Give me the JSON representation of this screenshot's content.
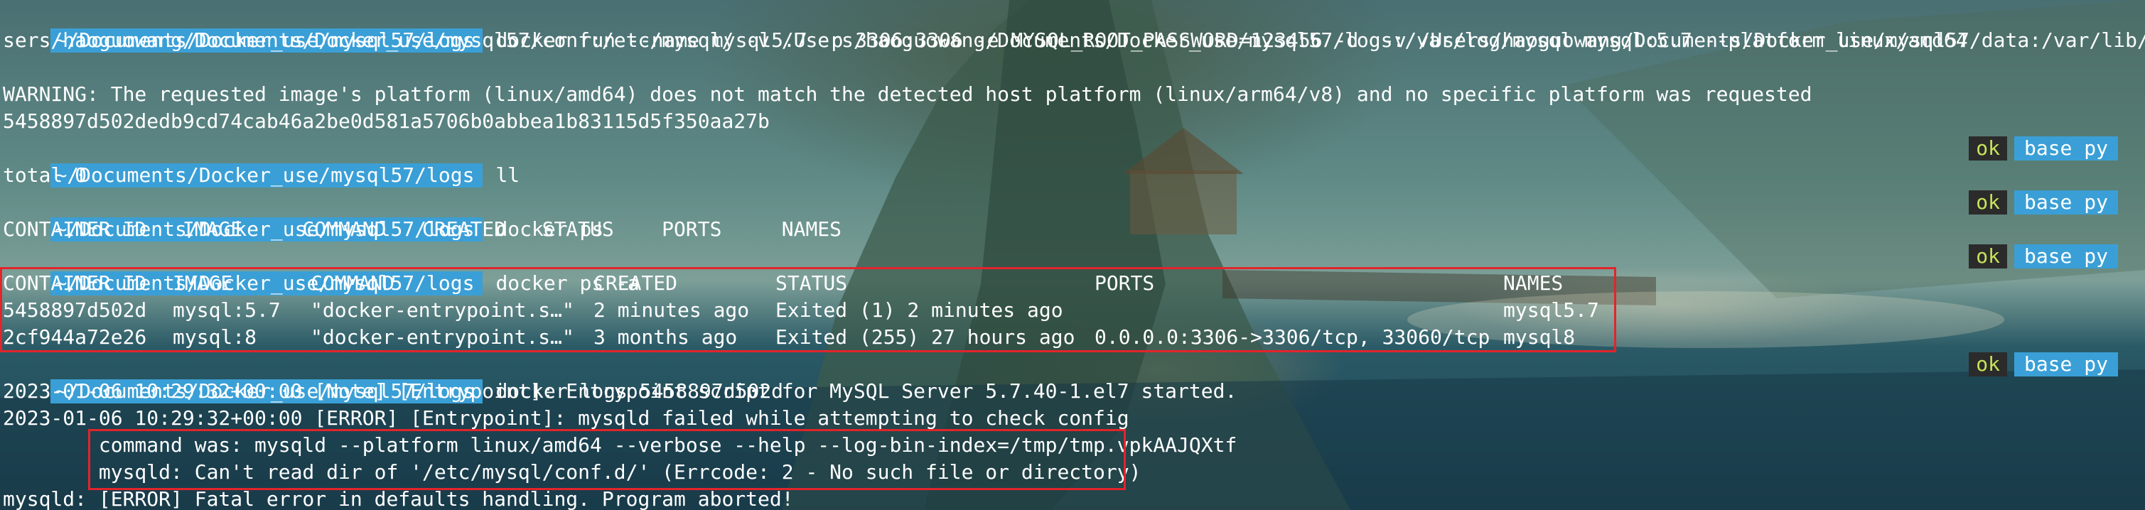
{
  "terminal": {
    "prompt_path": "~/Documents/Docker_use/mysql57/logs",
    "run_command_line1": "docker run --name mysql5.7 -p 3306:3306 -e MYSQL_ROOT_PASSWORD=123456 -d  -v /Users/haoguowang/Documents/Docker_use/mysql57/data:/var/lib/mysql -v /U",
    "run_command_line2": "sers/haoguowang/Documents/Docker_use/mysql57/conf:/etc/mysql/ -v /Users/haoguowang/Documents/Docker_use/mysql57/logs:/var/log/mysql mysql:5.7 --platform linux/amd64",
    "warning": "WARNING: The requested image's platform (linux/amd64) does not match the detected host platform (linux/arm64/v8) and no specific platform was requested",
    "container_hash": "5458897d502dedb9cd74cab46a2be0d581a5706b0abbea1b83115d5f350aa27b",
    "cmd_ll": "ll",
    "total": "total 0",
    "cmd_ps": "docker ps",
    "ps_header": "CONTAINER ID   IMAGE     COMMAND   CREATED   STATUS    PORTS     NAMES",
    "cmd_ps_a": "docker ps -a",
    "cmd_logs": "docker logs 5458897d502d",
    "log_lines": [
      "2023-01-06 10:29:32+00:00 [Note] [Entrypoint]: Entrypoint script for MySQL Server 5.7.40-1.el7 started.",
      "2023-01-06 10:29:32+00:00 [ERROR] [Entrypoint]: mysqld failed while attempting to check config",
      "        command was: mysqld --platform linux/amd64 --verbose --help --log-bin-index=/tmp/tmp.vpkAAJQXtf",
      "        mysqld: Can't read dir of '/etc/mysql/conf.d/' (Errcode: 2 - No such file or directory)",
      "mysqld: [ERROR] Fatal error in defaults handling. Program aborted!"
    ]
  },
  "status_badges": {
    "ok": "ok",
    "env": "base py"
  },
  "ps_a_table": {
    "headers": [
      "CONTAINER ID",
      "IMAGE",
      "COMMAND",
      "CREATED",
      "STATUS",
      "PORTS",
      "NAMES"
    ],
    "rows": [
      [
        "5458897d502d",
        "mysql:5.7",
        "\"docker-entrypoint.s…\"",
        "2 minutes ago",
        "Exited (1) 2 minutes ago",
        "",
        "mysql5.7"
      ],
      [
        "2cf944a72e26",
        "mysql:8",
        "\"docker-entrypoint.s…\"",
        "3 months ago",
        "Exited (255) 27 hours ago",
        "0.0.0.0:3306->3306/tcp, 33060/tcp",
        "mysql8"
      ]
    ]
  },
  "colors": {
    "prompt_bg": "#3a9fd6",
    "ok_fg": "#c7e35b",
    "highlight_box": "#e3242b"
  }
}
